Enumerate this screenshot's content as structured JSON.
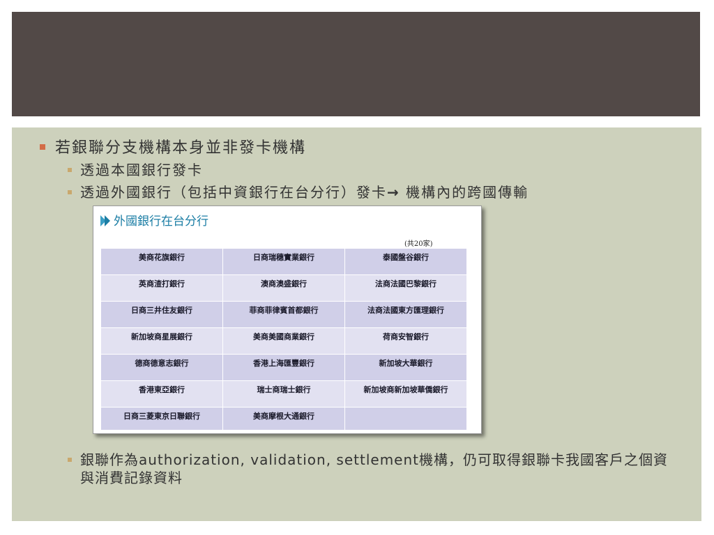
{
  "slide": {
    "bullet1": "若銀聯分支機構本身並非發卡機構",
    "bullet2a": "透過本國銀行發卡",
    "bullet2b_pre": "透過外國銀行（包括中資銀行在台分行）發卡",
    "bullet2b_arrow": "→",
    "bullet2b_post": " 機構內的跨國傳輸",
    "bullet2c": "銀聯作為authorization, validation, settlement機構，仍可取得銀聯卡我國客戶之個資與消費記錄資料"
  },
  "panel": {
    "title": "外國銀行在台分行",
    "count": "(共20家)",
    "rows": [
      [
        "美商花旗銀行",
        "日商瑞穗實業銀行",
        "泰國盤谷銀行"
      ],
      [
        "英商渣打銀行",
        "澳商澳盛銀行",
        "法商法國巴黎銀行"
      ],
      [
        "日商三井住友銀行",
        "菲商菲律賓首都銀行",
        "法商法國東方匯理銀行"
      ],
      [
        "新加坡商星展銀行",
        "美商美國商業銀行",
        "荷商安智銀行"
      ],
      [
        "德商德意志銀行",
        "香港上海匯豐銀行",
        "新加坡大華銀行"
      ],
      [
        "香港東亞銀行",
        "瑞士商瑞士銀行",
        "新加坡商新加坡華僑銀行"
      ],
      [
        "日商三菱東京日聯銀行",
        "美商摩根大通銀行",
        ""
      ]
    ]
  },
  "colors": {
    "title_band": "#524947",
    "content_bg": "#cdd1bc",
    "bullet1_marker": "#d36c47",
    "bullet2_marker": "#c9a86d",
    "panel_title": "#1c7ea5",
    "cell_dark": "#d0cfe8",
    "cell_light": "#e2e1f1"
  },
  "icons": {
    "panel_title_marker": "double-triangle-icon"
  }
}
